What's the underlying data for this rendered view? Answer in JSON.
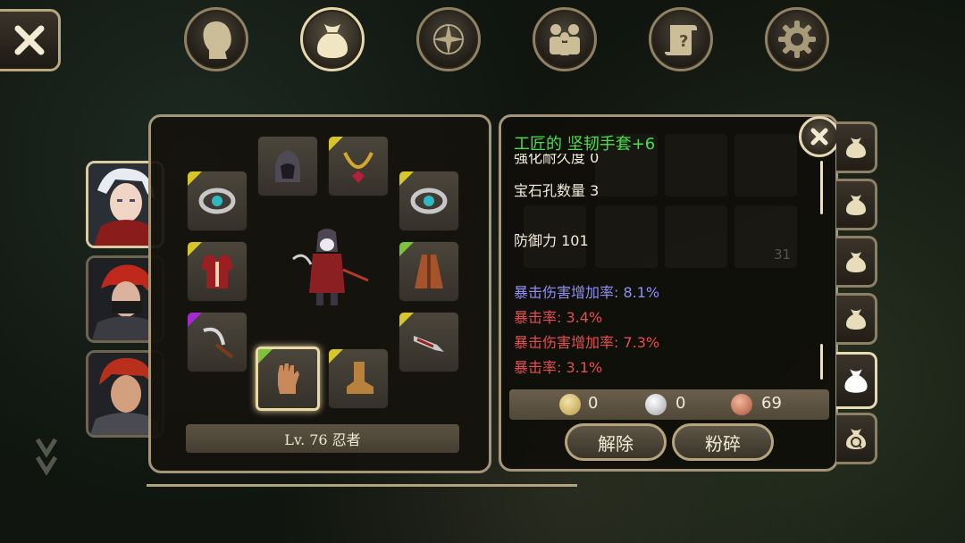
{
  "top_nav": {
    "items": [
      {
        "name": "character",
        "icon": "head-silhouette-icon"
      },
      {
        "name": "inventory",
        "icon": "bag-icon",
        "active": true
      },
      {
        "name": "skills",
        "icon": "sword-compass-icon"
      },
      {
        "name": "party",
        "icon": "people-icon"
      },
      {
        "name": "quests",
        "icon": "scroll-icon"
      },
      {
        "name": "settings",
        "icon": "gear-icon"
      }
    ]
  },
  "character": {
    "level_text": "Lv. 76 忍者"
  },
  "item": {
    "name": "工匠的 坚韧手套+6",
    "partial_line": "强化耐久度 0",
    "gem_slots": "宝石孔数量 3",
    "defense": "防御力 101",
    "stats": [
      {
        "text": "暴击伤害增加率: 8.1%",
        "color": "#8f8ff0"
      },
      {
        "text": "暴击率: 3.4%",
        "color": "#e05050"
      },
      {
        "text": "暴击伤害增加率: 7.3%",
        "color": "#e05050"
      },
      {
        "text": "暴击率: 3.1%",
        "color": "#e05050"
      }
    ],
    "name_color": "#49e04a"
  },
  "currency": {
    "gold": "0",
    "silver": "0",
    "copper": "69"
  },
  "bg_inventory": {
    "stack_count": "31"
  },
  "actions": {
    "unequip": "解除",
    "destroy": "粉碎"
  }
}
